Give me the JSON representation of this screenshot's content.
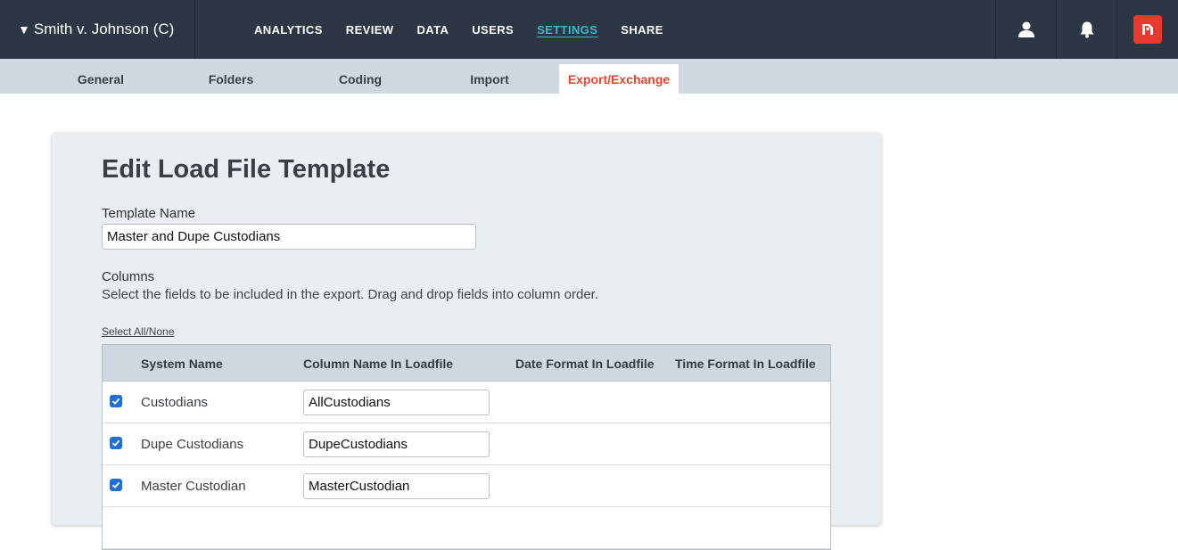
{
  "case": {
    "caret": "▼",
    "name": "Smith v. Johnson (C)"
  },
  "nav": [
    {
      "label": "ANALYTICS"
    },
    {
      "label": "REVIEW"
    },
    {
      "label": "DATA"
    },
    {
      "label": "USERS"
    },
    {
      "label": "SETTINGS",
      "active": true
    },
    {
      "label": "SHARE"
    }
  ],
  "top_icons": [
    "user-icon",
    "bell-icon",
    "app-logo-icon"
  ],
  "subtabs": [
    {
      "label": "General"
    },
    {
      "label": "Folders"
    },
    {
      "label": "Coding"
    },
    {
      "label": "Import"
    },
    {
      "label": "Export/Exchange",
      "active": true
    }
  ],
  "form": {
    "title": "Edit Load File Template",
    "template_name_label": "Template Name",
    "template_name_value": "Master and Dupe Custodians",
    "columns_label": "Columns",
    "columns_desc": "Select the fields to be included in the export. Drag and drop fields into column order.",
    "select_all": "Select All/None"
  },
  "table": {
    "headers": [
      "System Name",
      "Column Name In Loadfile",
      "Date Format In Loadfile",
      "Time Format In Loadfile"
    ],
    "rows": [
      {
        "checked": true,
        "system_name": "Custodians",
        "column_name": "AllCustodians"
      },
      {
        "checked": true,
        "system_name": "Dupe Custodians",
        "column_name": "DupeCustodians"
      },
      {
        "checked": true,
        "system_name": "Master Custodian",
        "column_name": "MasterCustodian"
      }
    ]
  },
  "colors": {
    "topbar": "#2c3644",
    "accent_teal": "#3cb8c8",
    "accent_orange": "#e8452c",
    "checkbox": "#1e6fd9"
  }
}
